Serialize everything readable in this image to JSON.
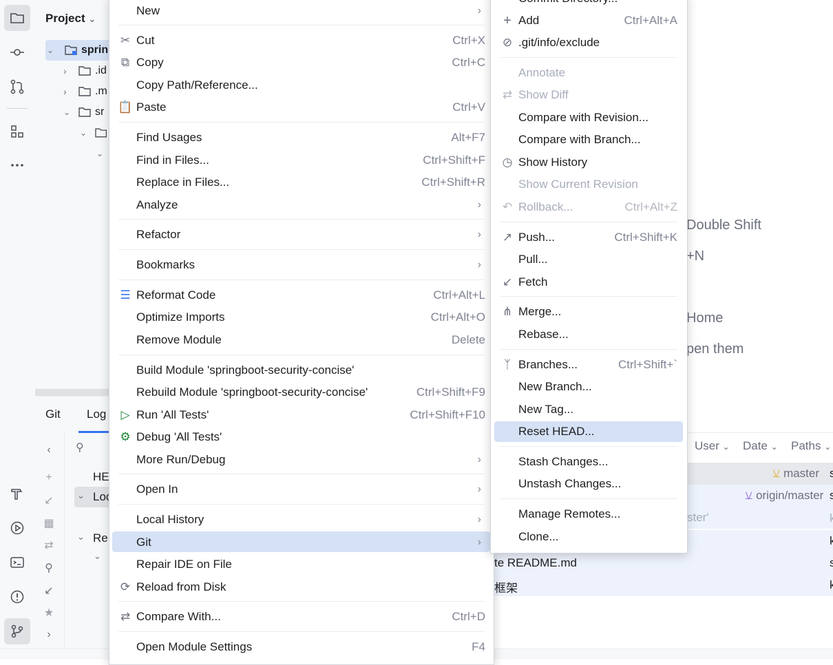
{
  "project_panel": {
    "title": "Project",
    "tree": [
      {
        "label": "sprin"
      },
      {
        "label": ".id"
      },
      {
        "label": ".m"
      },
      {
        "label": "sr"
      }
    ]
  },
  "git_panel": {
    "tabs": [
      "Git",
      "Log"
    ],
    "refs": {
      "head": "HE",
      "local": "Loc",
      "remote": "Re"
    }
  },
  "welcome_hints": [
    {
      "text": "Double Shift"
    },
    {
      "text": "+N"
    },
    {
      "text": "Home"
    },
    {
      "text": "pen them"
    }
  ],
  "log": {
    "columns": [
      "User",
      "Date",
      "Paths"
    ],
    "tags": {
      "master": "master",
      "origin": "origin/master"
    },
    "commit_fragments": [
      "ster'",
      "te README.md",
      "框架"
    ],
    "right_chars": [
      "s",
      "s",
      "k",
      "k",
      "s",
      "k"
    ]
  },
  "main_menu": {
    "items": [
      {
        "label": "New",
        "submenu": true
      },
      {
        "label": "Cut",
        "shortcut": "Ctrl+X",
        "icon": "scissors-icon"
      },
      {
        "label": "Copy",
        "shortcut": "Ctrl+C",
        "icon": "copy-icon"
      },
      {
        "label": "Copy Path/Reference..."
      },
      {
        "label": "Paste",
        "shortcut": "Ctrl+V",
        "icon": "paste-icon"
      },
      {
        "label": "Find Usages",
        "shortcut": "Alt+F7"
      },
      {
        "label": "Find in Files...",
        "shortcut": "Ctrl+Shift+F"
      },
      {
        "label": "Replace in Files...",
        "shortcut": "Ctrl+Shift+R"
      },
      {
        "label": "Analyze",
        "submenu": true
      },
      {
        "label": "Refactor",
        "submenu": true
      },
      {
        "label": "Bookmarks",
        "submenu": true
      },
      {
        "label": "Reformat Code",
        "shortcut": "Ctrl+Alt+L",
        "icon": "reformat-icon"
      },
      {
        "label": "Optimize Imports",
        "shortcut": "Ctrl+Alt+O"
      },
      {
        "label": "Remove Module",
        "shortcut": "Delete"
      },
      {
        "label": "Build Module 'springboot-security-concise'"
      },
      {
        "label": "Rebuild Module 'springboot-security-concise'",
        "shortcut": "Ctrl+Shift+F9"
      },
      {
        "label": "Run 'All Tests'",
        "shortcut": "Ctrl+Shift+F10",
        "icon": "run-icon"
      },
      {
        "label": "Debug 'All Tests'",
        "icon": "debug-icon"
      },
      {
        "label": "More Run/Debug",
        "submenu": true
      },
      {
        "label": "Open In",
        "submenu": true
      },
      {
        "label": "Local History",
        "submenu": true
      },
      {
        "label": "Git",
        "submenu": true
      },
      {
        "label": "Repair IDE on File"
      },
      {
        "label": "Reload from Disk",
        "icon": "reload-icon"
      },
      {
        "label": "Compare With...",
        "shortcut": "Ctrl+D",
        "icon": "compare-icon"
      },
      {
        "label": "Open Module Settings",
        "shortcut": "F4"
      }
    ]
  },
  "git_menu": {
    "items": [
      {
        "label": "Commit Directory..."
      },
      {
        "label": "Add",
        "shortcut": "Ctrl+Alt+A",
        "icon": "plus-icon"
      },
      {
        "label": ".git/info/exclude",
        "icon": "ignore-icon"
      },
      {
        "label": "Annotate",
        "disabled": true
      },
      {
        "label": "Show Diff",
        "disabled": true,
        "icon": "diff-icon"
      },
      {
        "label": "Compare with Revision..."
      },
      {
        "label": "Compare with Branch..."
      },
      {
        "label": "Show History",
        "icon": "history-icon"
      },
      {
        "label": "Show Current Revision",
        "disabled": true
      },
      {
        "label": "Rollback...",
        "shortcut": "Ctrl+Alt+Z",
        "disabled": true,
        "icon": "rollback-icon"
      },
      {
        "label": "Push...",
        "shortcut": "Ctrl+Shift+K",
        "icon": "push-icon"
      },
      {
        "label": "Pull..."
      },
      {
        "label": "Fetch",
        "icon": "fetch-icon"
      },
      {
        "label": "Merge...",
        "icon": "merge-icon"
      },
      {
        "label": "Rebase..."
      },
      {
        "label": "Branches...",
        "shortcut": "Ctrl+Shift+`",
        "icon": "branch-icon"
      },
      {
        "label": "New Branch..."
      },
      {
        "label": "New Tag..."
      },
      {
        "label": "Reset HEAD..."
      },
      {
        "label": "Stash Changes..."
      },
      {
        "label": "Unstash Changes..."
      },
      {
        "label": "Manage Remotes..."
      },
      {
        "label": "Clone..."
      }
    ]
  },
  "colors": {
    "selection": "#d5e1f5",
    "accent": "#3574f0",
    "disabled_text": "#a8adbd"
  }
}
